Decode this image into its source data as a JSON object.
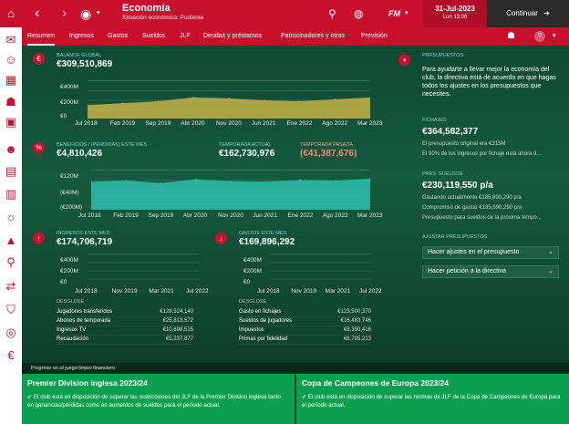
{
  "header": {
    "title": "Economía",
    "subtitle": "Situación económica: Pudiente",
    "date": "31-Jul-2023",
    "day_time": "Lun 13:00",
    "continue_label": "Continuar",
    "fm_logo": "FM"
  },
  "tabs": [
    "Resumen",
    "Ingresos",
    "Gastos",
    "Sueldos",
    "JLF",
    "Deudas y préstamos",
    "Patrocinadores y otros",
    "Previsión"
  ],
  "balance": {
    "label": "Balance global",
    "value": "€309,510,869",
    "y_ticks": [
      "€400M",
      "€200M",
      "€0"
    ],
    "x_ticks": [
      "Jul 2018",
      "Feb 2019",
      "Sep 2019",
      "Abr 2020",
      "Nov 2020",
      "Jun 2021",
      "Ene 2022",
      "Ago 2022",
      "Mar 2023"
    ]
  },
  "profit": {
    "label": "Beneficios / (pérdidas) este mes",
    "value": "€4,810,426",
    "season_label": "Temporada actual",
    "season_value": "€162,730,976",
    "last_label": "Temporada pasada",
    "last_value": "(€41,387,676)",
    "y_ticks": [
      "€120M",
      "(€40M)",
      "(€200M)"
    ],
    "x_ticks": [
      "Jul 2018",
      "Feb 2019",
      "Sep 2019",
      "Abr 2020",
      "Nov 2020",
      "Jun 2021",
      "Ene 2022",
      "Ago 2022",
      "Mar 2023"
    ]
  },
  "income": {
    "label": "Ingresos este mes",
    "value": "€174,706,719",
    "y_ticks": [
      "€400M",
      "€200M",
      "€0"
    ],
    "x_ticks": [
      "Jul 2018",
      "Nov 2019",
      "Mar 2021",
      "Jul 2022"
    ],
    "breakdown_label": "Desglose",
    "rows": [
      {
        "name": "Jugadores transferidos",
        "value": "€128,524,140"
      },
      {
        "name": "Abonos de temporada",
        "value": "€25,813,572"
      },
      {
        "name": "Ingresos TV",
        "value": "€10,698,515"
      },
      {
        "name": "Recaudación",
        "value": "€5,237,877"
      }
    ]
  },
  "expenses": {
    "label": "Gastos este mes",
    "value": "€169,896,292",
    "y_ticks": [
      "€400M",
      "€200M",
      "€0"
    ],
    "x_ticks": [
      "Jul 2018",
      "Nov 2019",
      "Mar 2021",
      "Jul 2022"
    ],
    "breakdown_label": "Desglose",
    "rows": [
      {
        "name": "Gasto en fichajes",
        "value": "€123,500,370"
      },
      {
        "name": "Sueldos de jugadores",
        "value": "€16,483,746"
      },
      {
        "name": "Impuestos",
        "value": "€8,390,416"
      },
      {
        "name": "Primas por fidelidad",
        "value": "€6,785,213"
      }
    ]
  },
  "budget": {
    "label": "Presupuestos",
    "intro": "Para ayudarte a llevar mejor la economía del club, la directiva está de acuerdo en que hagas todos los ajustes en los presupuestos que necesites.",
    "transfer_label": "Fichajes",
    "transfer_value": "€364,582,377",
    "transfer_note1": "El presupuesto original era €315M",
    "transfer_note2": "El 90% de los ingresos por fichaje está ahora d...",
    "wage_label": "Pres. sueldos",
    "wage_value": "€230,119,550 p/a",
    "wage_note1": "Gastando actualmente €185,690,290 p/a",
    "wage_note2": "Compromiso de gastar €185,690,290 p/a",
    "wage_note3": "Presupuesto para sueldos de la próxima tempo...",
    "adjust_label": "Ajustar presupuestos",
    "dropdown1": "Hacer ajustes en el presupuesto",
    "dropdown2": "Hacer petición a la directiva"
  },
  "progress_label": "Progreso en el juego limpio financiero",
  "footer": {
    "left_title": "Premier Division inglesa 2023/24",
    "left_text": "El club está en disposición de superar las restricciones del JLF de la Premier Division inglesa tanto en ganancias/pérdidas como en aumentos de sueldos para el período actual.",
    "right_title": "Copa de Campeones de Europa 2023/24",
    "right_text": "El club está en disposición de superar las normas de JLF de la Copa de Campeones de Europa para el período actual."
  },
  "chart_data": [
    {
      "type": "area",
      "title": "Balance global",
      "x": [
        "Jul 2018",
        "Feb 2019",
        "Sep 2019",
        "Abr 2020",
        "Nov 2020",
        "Jun 2021",
        "Ene 2022",
        "Ago 2022",
        "Mar 2023"
      ],
      "values": [
        150,
        170,
        190,
        230,
        220,
        200,
        190,
        210,
        230
      ],
      "ylim": [
        0,
        400
      ],
      "color": "#c8b24a"
    },
    {
      "type": "area",
      "title": "Beneficios / (pérdidas) este mes",
      "x": [
        "Jul 2018",
        "Feb 2019",
        "Sep 2019",
        "Abr 2020",
        "Nov 2020",
        "Jun 2021",
        "Ene 2022",
        "Ago 2022",
        "Mar 2023"
      ],
      "values": [
        30,
        40,
        20,
        50,
        35,
        30,
        45,
        40,
        55
      ],
      "ylim": [
        -200,
        120
      ],
      "color": "#2fbfb0"
    },
    {
      "type": "area",
      "title": "Ingresos este mes",
      "x": [
        "Jul 2018",
        "Nov 2019",
        "Mar 2021",
        "Jul 2022"
      ],
      "values": [
        10,
        10,
        10,
        10
      ],
      "ylim": [
        0,
        400
      ],
      "color": "#b7b7b7"
    },
    {
      "type": "area",
      "title": "Gastos este mes",
      "x": [
        "Jul 2018",
        "Nov 2019",
        "Mar 2021",
        "Jul 2022"
      ],
      "values": [
        10,
        10,
        10,
        10
      ],
      "ylim": [
        0,
        400
      ],
      "color": "#c8b24a"
    }
  ]
}
